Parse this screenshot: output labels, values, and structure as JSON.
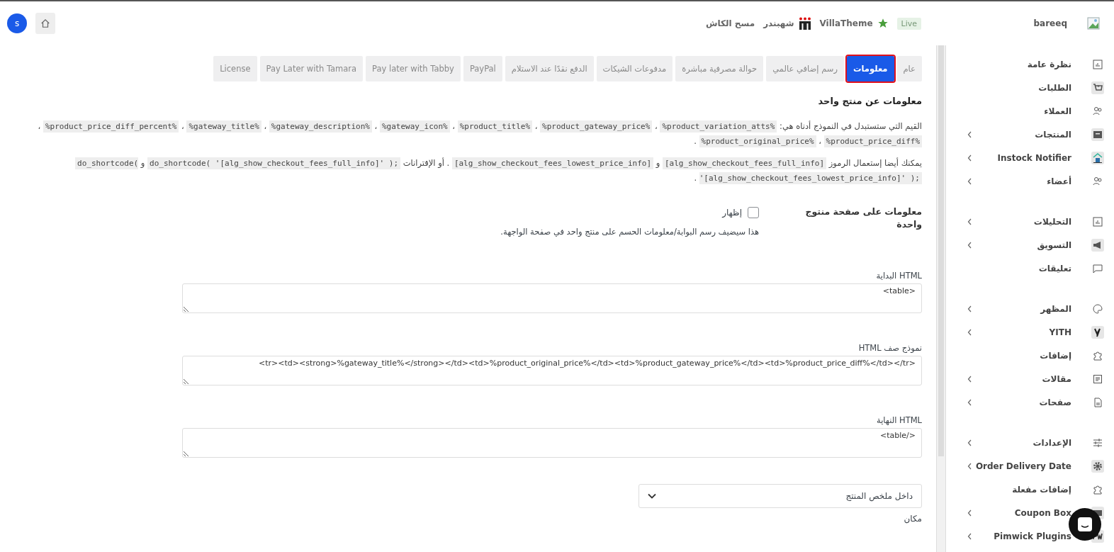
{
  "header": {
    "site_name": "bareeq",
    "badge": "Live",
    "links": [
      {
        "label": "VillaTheme",
        "kind": "star"
      },
      {
        "label": "شهبندر",
        "kind": "brand"
      },
      {
        "label": "مسح الكاش",
        "kind": "plain"
      }
    ],
    "avatar": "s"
  },
  "sidebar": {
    "groups": [
      [
        {
          "label": "نظرة عامة",
          "expandable": false
        },
        {
          "label": "الطلبات",
          "expandable": false
        },
        {
          "label": "العملاء",
          "expandable": false
        },
        {
          "label": "المنتجات",
          "expandable": true
        },
        {
          "label": "Instock Notifier",
          "expandable": true
        },
        {
          "label": "أعضاء",
          "expandable": true
        }
      ],
      [
        {
          "label": "التحليلات",
          "expandable": true
        },
        {
          "label": "التسويق",
          "expandable": true
        },
        {
          "label": "تعليقات",
          "expandable": false
        }
      ],
      [
        {
          "label": "المظهر",
          "expandable": true
        },
        {
          "label": "YITH",
          "expandable": true
        },
        {
          "label": "إضافات",
          "expandable": false
        },
        {
          "label": "مقالات",
          "expandable": true
        },
        {
          "label": "صفحات",
          "expandable": true
        }
      ],
      [
        {
          "label": "الإعدادات",
          "expandable": true
        },
        {
          "label": "Order Delivery Date",
          "expandable": true
        },
        {
          "label": "إضافات مفعلة",
          "expandable": false
        },
        {
          "label": "Coupon Box",
          "expandable": true
        },
        {
          "label": "Pimwick Plugins",
          "expandable": true
        }
      ]
    ]
  },
  "tabs": [
    {
      "label": "عام",
      "selected": false
    },
    {
      "label": "معلومات",
      "selected": true
    },
    {
      "label": "رسم إضافي عالمي",
      "selected": false
    },
    {
      "label": "حوالة مصرفية مباشرة",
      "selected": false
    },
    {
      "label": "مدفوعات الشيكات",
      "selected": false
    },
    {
      "label": "الدفع نقدًا عند الاستلام",
      "selected": false
    },
    {
      "label": "PayPal",
      "selected": false
    },
    {
      "label": "Pay later with Tabby",
      "selected": false
    },
    {
      "label": "Pay Later with Tamara",
      "selected": false
    },
    {
      "label": "License",
      "selected": false
    }
  ],
  "section_title": "معلومات عن منتج واحد",
  "paragraphs": [
    [
      {
        "text": "القيم التي ستستبدل في النموذج أدناه هي: ",
        "code": false
      },
      {
        "text": "%product_variation_atts%",
        "code": true
      },
      {
        "text": " ، ",
        "code": false
      },
      {
        "text": "%product_gateway_price%",
        "code": true
      },
      {
        "text": " ، ",
        "code": false
      },
      {
        "text": "%product_title%",
        "code": true
      },
      {
        "text": " ، ",
        "code": false
      },
      {
        "text": "%gateway_icon%",
        "code": true
      },
      {
        "text": " ، ",
        "code": false
      },
      {
        "text": "%gateway_description%",
        "code": true
      },
      {
        "text": " ، ",
        "code": false
      },
      {
        "text": "%gateway_title%",
        "code": true
      },
      {
        "text": " ، ",
        "code": false
      },
      {
        "text": "%product_price_diff_percent%",
        "code": true
      },
      {
        "text": " ، ",
        "code": false
      },
      {
        "text": "%product_price_diff%",
        "code": true
      },
      {
        "text": " ، ",
        "code": false
      },
      {
        "text": "%product_original_price%",
        "code": true
      },
      {
        "text": " .",
        "code": false
      }
    ],
    [
      {
        "text": "يمكنك أيضا إستعمال الرموز ",
        "code": false
      },
      {
        "text": "[alg_show_checkout_fees_full_info]",
        "code": true
      },
      {
        "text": " و ",
        "code": false
      },
      {
        "text": "[alg_show_checkout_fees_lowest_price_info]",
        "code": true
      },
      {
        "text": " . أو الإقترانات ",
        "code": false
      },
      {
        "text": "do_shortcode( '[alg_show_checkout_fees_full_info]' );",
        "code": true
      },
      {
        "text": " و ",
        "code": false
      },
      {
        "text": "do_shortcode( '[alg_show_checkout_fees_lowest_price_info]' );",
        "code": true
      },
      {
        "text": " .",
        "code": false
      }
    ]
  ],
  "single_product": {
    "label": "معلومات على صفحة منتوج واحدة",
    "checkbox": {
      "label": "إظهار",
      "checked": false
    },
    "description": "هذا سيضيف رسم البوابة/معلومات الحسم على منتج واحد في صفحة الواجهة."
  },
  "textareas": [
    {
      "label": "HTML البداية",
      "value": "<table>"
    },
    {
      "label": "نموذج صف HTML",
      "value": "<tr><td><strong>%gateway_title%</strong></td><td>%product_original_price%</td><td>%product_gateway_price%</td><td>%product_price_diff%</td></tr>"
    },
    {
      "label": "HTML النهاية",
      "value": "</table>"
    }
  ],
  "position": {
    "value": "داخل ملخص المنتج",
    "label": "مكان"
  }
}
